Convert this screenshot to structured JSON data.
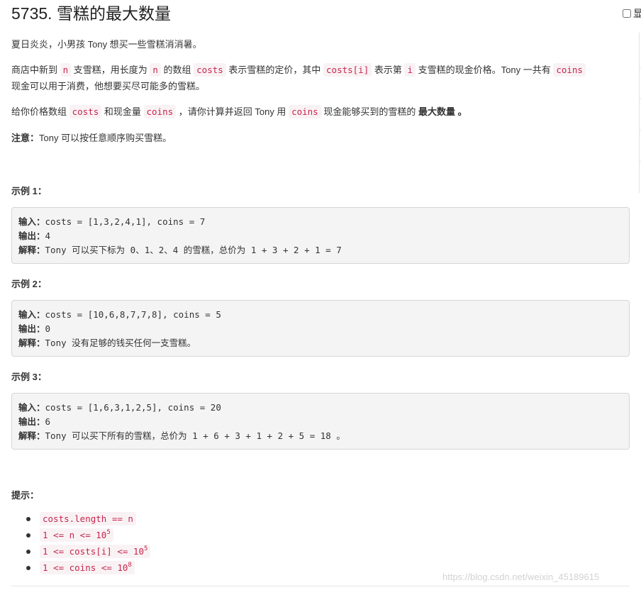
{
  "problem": {
    "title": "5735. 雪糕的最大数量",
    "show_toggle_label": "显"
  },
  "description": {
    "intro": "夏日炎炎，小男孩 Tony 想买一些雪糕消消暑。",
    "p2_a": "商店中新到 ",
    "p2_code_n1": "n",
    "p2_b": " 支雪糕，用长度为 ",
    "p2_code_n2": "n",
    "p2_c": " 的数组 ",
    "p2_code_costs": "costs",
    "p2_d": " 表示雪糕的定价，其中 ",
    "p2_code_costsi": "costs[i]",
    "p2_e": " 表示第 ",
    "p2_code_i": "i",
    "p2_f": " 支雪糕的现金价格。Tony 一共有 ",
    "p2_code_coins": "coins",
    "p2_line2": "现金可以用于消费，他想要买尽可能多的雪糕。",
    "p3_a": "给你价格数组 ",
    "p3_code_costs": "costs",
    "p3_b": " 和现金量 ",
    "p3_code_coins": "coins",
    "p3_c": " ，请你计算并返回 Tony 用 ",
    "p3_code_coins2": "coins",
    "p3_d": " 现金能够买到的雪糕的 ",
    "p3_bold": "最大数量",
    "p3_e": " 。",
    "note_label": "注意：",
    "note_text": "Tony 可以按任意顺序购买雪糕。"
  },
  "examples": [
    {
      "heading": "示例 1：",
      "input_label": "输入：",
      "input": "costs = [1,3,2,4,1], coins = 7",
      "output_label": "输出：",
      "output": "4",
      "explain_label": "解释：",
      "explain": "Tony 可以买下标为 0、1、2、4 的雪糕，总价为 1 + 3 + 2 + 1 = 7"
    },
    {
      "heading": "示例 2：",
      "input_label": "输入：",
      "input": "costs = [10,6,8,7,7,8], coins = 5",
      "output_label": "输出：",
      "output": "0",
      "explain_label": "解释：",
      "explain": "Tony 没有足够的钱买任何一支雪糕。"
    },
    {
      "heading": "示例 3：",
      "input_label": "输入：",
      "input": "costs = [1,6,3,1,2,5], coins = 20",
      "output_label": "输出：",
      "output": "6",
      "explain_label": "解释：",
      "explain": "Tony 可以买下所有的雪糕，总价为 1 + 6 + 3 + 1 + 2 + 5 = 18 。"
    }
  ],
  "constraints": {
    "heading": "提示：",
    "items": [
      {
        "code": "costs.length == n",
        "sup": ""
      },
      {
        "code": "1 <= n <= 10",
        "sup": "5"
      },
      {
        "code": "1 <= costs[i] <= 10",
        "sup": "5"
      },
      {
        "code": "1 <= coins <= 10",
        "sup": "8"
      }
    ]
  },
  "watermark": "https://blog.csdn.net/weixin_45189615"
}
